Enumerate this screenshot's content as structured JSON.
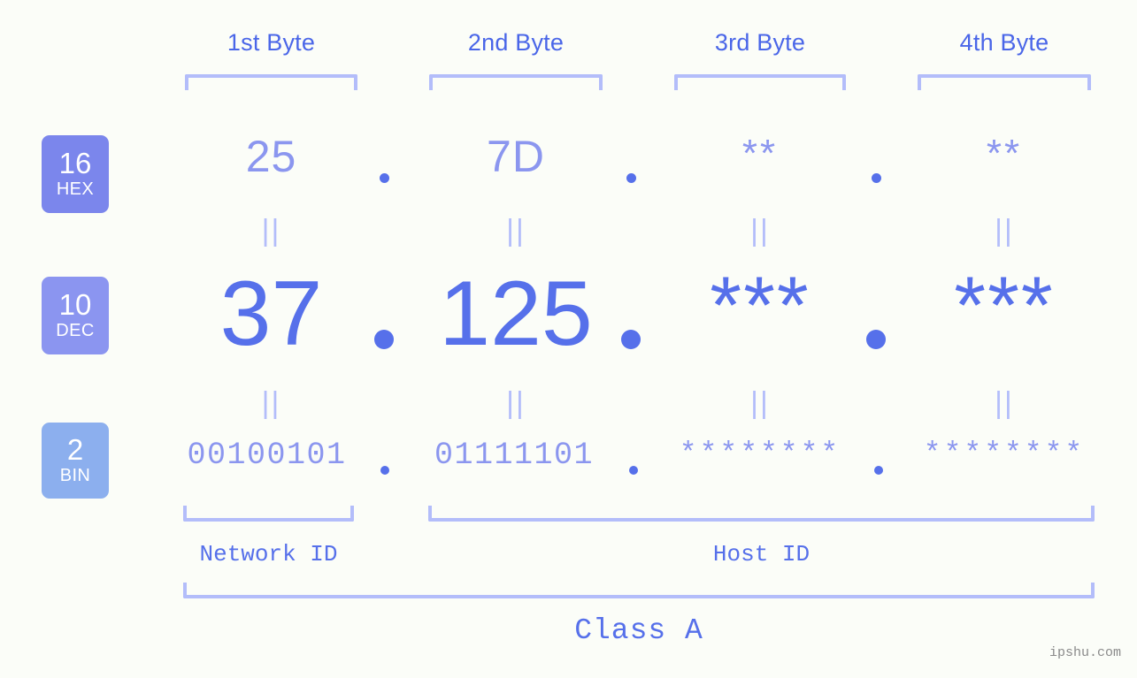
{
  "page": {
    "watermark": "ipshu.com",
    "background_color": "#fbfdf8",
    "accent_color": "#5670ea",
    "accent_light_color": "#8b96ef",
    "bracket_color": "#b3bdfa"
  },
  "byte_headers": [
    {
      "label": "1st Byte"
    },
    {
      "label": "2nd Byte"
    },
    {
      "label": "3rd Byte"
    },
    {
      "label": "4th Byte"
    }
  ],
  "bases": [
    {
      "number": "16",
      "name": "HEX",
      "color": "#7b86ec"
    },
    {
      "number": "10",
      "name": "DEC",
      "color": "#8b95f0"
    },
    {
      "number": "2",
      "name": "BIN",
      "color": "#8cafee"
    }
  ],
  "rows": {
    "hex": {
      "base_number": "16",
      "base_name": "HEX",
      "values": [
        "25",
        "7D",
        "**",
        "**"
      ],
      "separator": "."
    },
    "dec": {
      "base_number": "10",
      "base_name": "DEC",
      "values": [
        "37",
        "125",
        "***",
        "***"
      ],
      "separator": "."
    },
    "bin": {
      "base_number": "2",
      "base_name": "BIN",
      "values": [
        "00100101",
        "01111101",
        "********",
        "********"
      ],
      "separator": "."
    }
  },
  "equality_marks": {
    "glyph": "||",
    "count_per_row": 4,
    "rows": 2
  },
  "segments": {
    "network_id": "Network ID",
    "host_id": "Host ID",
    "class": "Class A"
  }
}
